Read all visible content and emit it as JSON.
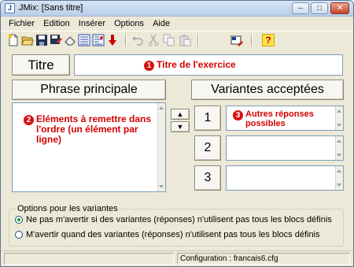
{
  "window": {
    "title": "JMix: [Sans titre]",
    "app_icon_glyph": "J",
    "minimize_glyph": "–",
    "maximize_glyph": "□",
    "close_glyph": "✕"
  },
  "menu": {
    "items": [
      {
        "label": "Fichier"
      },
      {
        "label": "Edition"
      },
      {
        "label": "Insérer"
      },
      {
        "label": "Options"
      },
      {
        "label": "Aide"
      }
    ]
  },
  "toolbar": {
    "icons": [
      "new-file-icon",
      "open-folder-icon",
      "save-icon",
      "save-as-icon",
      "clear-icon",
      "export-web-icon",
      "export-web2-icon",
      "arrow-down-red-icon",
      "undo-icon",
      "cut-icon",
      "copy-icon",
      "paste-icon",
      "config-icon",
      "help-icon"
    ],
    "help_glyph": "?"
  },
  "title_section": {
    "button_label": "Titre",
    "hint_number": "1",
    "hint_text": "Titre de l'exercice"
  },
  "main_phrase": {
    "header": "Phrase principale",
    "hint_number": "2",
    "hint_text": "Eléments à remettre dans l'ordre (un élément par ligne)"
  },
  "variants": {
    "header": "Variantes acceptées",
    "up_glyph": "▲",
    "down_glyph": "▼",
    "rows": [
      {
        "number": "1",
        "hint_number": "3",
        "hint_text": "Autres réponses possibles"
      },
      {
        "number": "2"
      },
      {
        "number": "3"
      }
    ]
  },
  "options": {
    "legend": "Options pour les variantes",
    "radios": [
      {
        "label": "Ne pas m'avertir si des variantes (réponses) n'utilisent pas tous les blocs définis",
        "selected": true
      },
      {
        "label": "M'avertir quand des variantes (réponses) n'utilisent pas tous les blocs définis",
        "selected": false
      }
    ]
  },
  "status": {
    "configuration": "Configuration : francais6.cfg"
  },
  "colors": {
    "hint_red": "#d40000",
    "window_bg": "#ece9d8"
  }
}
